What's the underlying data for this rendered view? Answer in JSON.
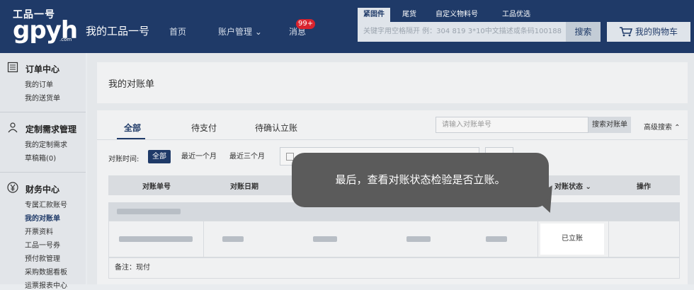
{
  "header": {
    "logo_top": "工品一号",
    "logo_main": "gpyh",
    "logo_sub": ".com",
    "site_name": "我的工品一号",
    "nav": [
      "首页",
      "账户管理 ⌄",
      "消息"
    ],
    "message_badge": "99+",
    "search_tabs": [
      "紧固件",
      "尾货",
      "自定义物料号",
      "工品优选"
    ],
    "search_placeholder": "关键字用空格隔开 例：304 819 3*10中文描述或条码100188",
    "search_button": "搜索",
    "cart_label": "我的购物车"
  },
  "sidebar": {
    "sections": [
      {
        "title": "订单中心",
        "icon": "list-icon",
        "links": [
          "我的订单",
          "我的送货单"
        ]
      },
      {
        "title": "定制需求管理",
        "icon": "person-icon",
        "links": [
          "我的定制需求",
          "草稿箱(0)"
        ]
      },
      {
        "title": "财务中心",
        "icon": "yen-icon",
        "links": [
          "专属汇款账号",
          "我的对账单",
          "开票资料",
          "工品一号券",
          "预付款管理",
          "采购数据看板",
          "运票报表中心"
        ]
      }
    ],
    "current_link": "我的对账单"
  },
  "page": {
    "title": "我的对账单",
    "tabs": [
      "全部",
      "待支付",
      "待确认立账"
    ],
    "order_input_placeholder": "请输入对账单号",
    "order_search_button": "搜索对账单",
    "advanced_search": "高级搜索 ⌃",
    "time_label": "对账时间:",
    "time_filters": [
      "全部",
      "最近一个月",
      "最近三个月"
    ],
    "columns": [
      "对账单号",
      "对账日期",
      "对账状态 ⌄",
      "操作"
    ],
    "row_status": "已立账",
    "note": "备注：现付"
  },
  "tooltip": {
    "text": "最后，查看对账状态检验是否立账。"
  },
  "colors": {
    "header_bg": "#1f3a68",
    "accent": "#1f3a68",
    "badge": "#d9232e",
    "bubble": "#5b5b5b"
  }
}
